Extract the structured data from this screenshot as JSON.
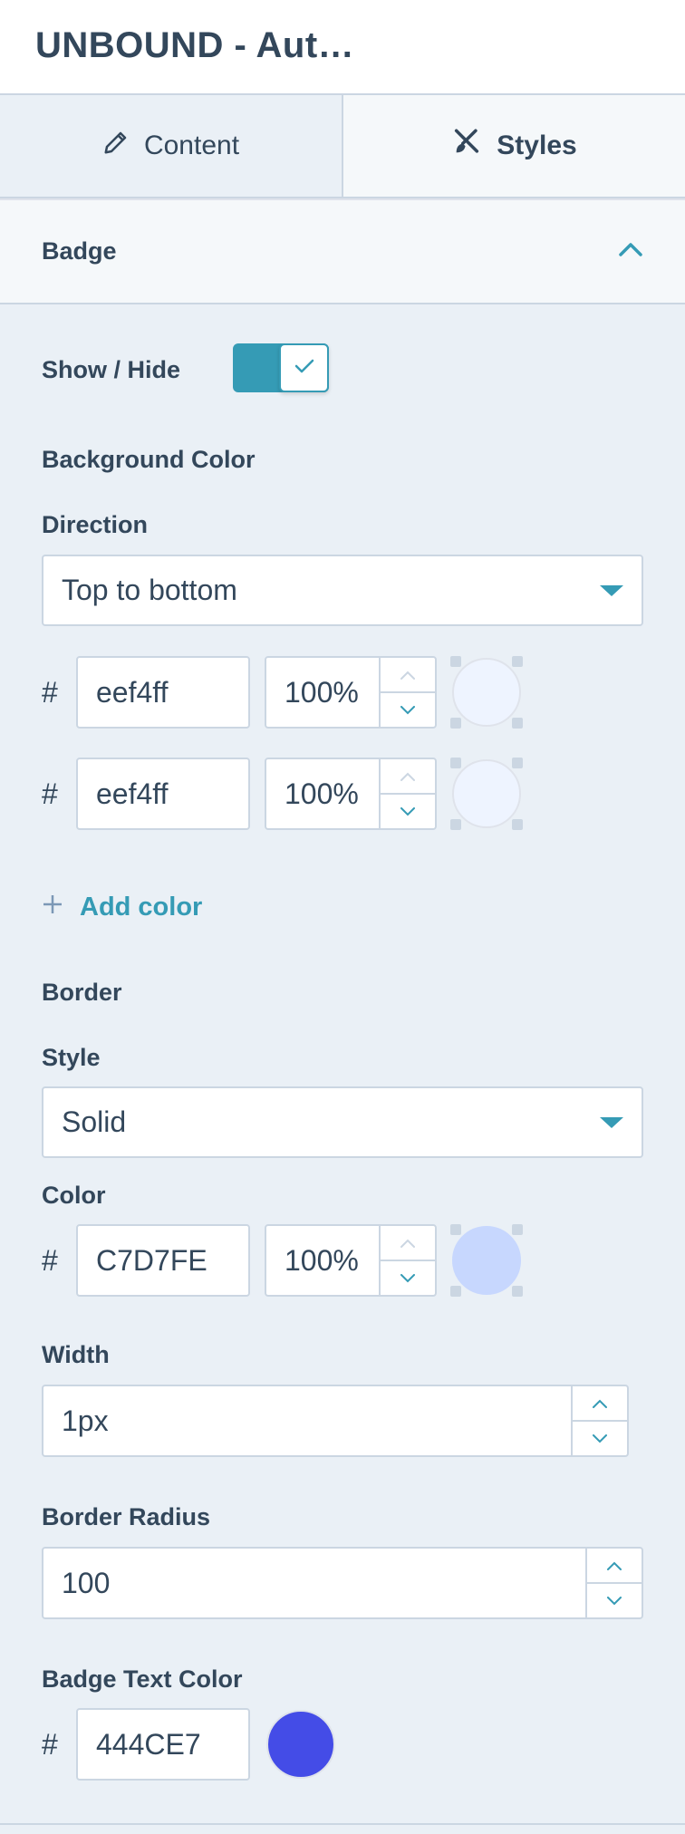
{
  "header": {
    "title": "UNBOUND - Aut…"
  },
  "tabs": [
    {
      "label": "Content",
      "icon": "pencil-icon"
    },
    {
      "label": "Styles",
      "icon": "brush-icon"
    }
  ],
  "section": {
    "title": "Badge",
    "icon": "chevron-up-icon"
  },
  "show_hide": {
    "label": "Show / Hide",
    "checked": true
  },
  "background_color": {
    "label": "Background Color",
    "direction_label": "Direction",
    "direction_value": "Top to bottom",
    "colors": [
      {
        "hash": "#",
        "hex": "eef4ff",
        "opacity": "100%",
        "swatch": "#eef4ff"
      },
      {
        "hash": "#",
        "hex": "eef4ff",
        "opacity": "100%",
        "swatch": "#eef4ff"
      }
    ],
    "add_color_label": "Add color"
  },
  "border": {
    "label": "Border",
    "style_label": "Style",
    "style_value": "Solid",
    "color_label": "Color",
    "color": {
      "hash": "#",
      "hex": "C7D7FE",
      "opacity": "100%",
      "swatch": "#c7d7fe"
    },
    "width_label": "Width",
    "width_value": "1px",
    "radius_label": "Border Radius",
    "radius_value": "100"
  },
  "badge_text_color": {
    "label": "Badge Text Color",
    "hash": "#",
    "hex": "444CE7",
    "swatch": "#444ce7"
  },
  "colors": {
    "accent": "#359bb5",
    "text": "#33475b",
    "border": "#cbd6e2",
    "panel": "#eaf0f6"
  }
}
